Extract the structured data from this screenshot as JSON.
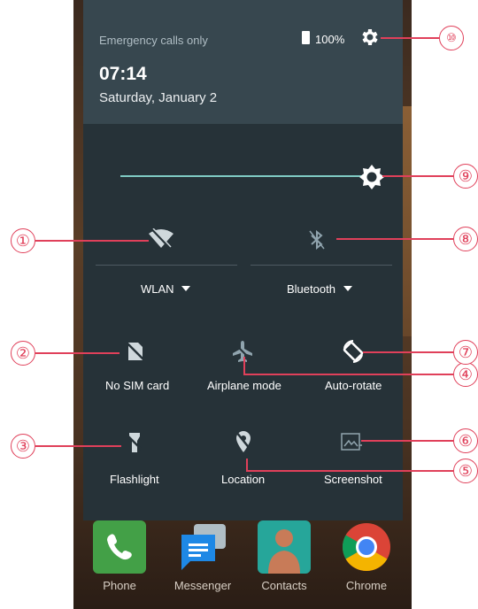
{
  "status": {
    "carrier": "Emergency calls only",
    "battery": "100%"
  },
  "clock": {
    "time": "07:14",
    "date": "Saturday, January 2"
  },
  "brightness": {
    "level": 0.87
  },
  "tiles": {
    "wlan": "WLAN",
    "bluetooth": "Bluetooth",
    "sim": "No SIM card",
    "airplane": "Airplane mode",
    "autorotate": "Auto-rotate",
    "flashlight": "Flashlight",
    "location": "Location",
    "screenshot": "Screenshot"
  },
  "dock": {
    "phone": "Phone",
    "messenger": "Messenger",
    "contacts": "Contacts",
    "chrome": "Chrome"
  },
  "annotations": [
    "①",
    "②",
    "③",
    "④",
    "⑤",
    "⑥",
    "⑦",
    "⑧",
    "⑨",
    "⑩"
  ],
  "colors": {
    "panel": "#263238",
    "header": "#37474f",
    "accent": "#80cbc4",
    "annotation": "#e0405a"
  }
}
